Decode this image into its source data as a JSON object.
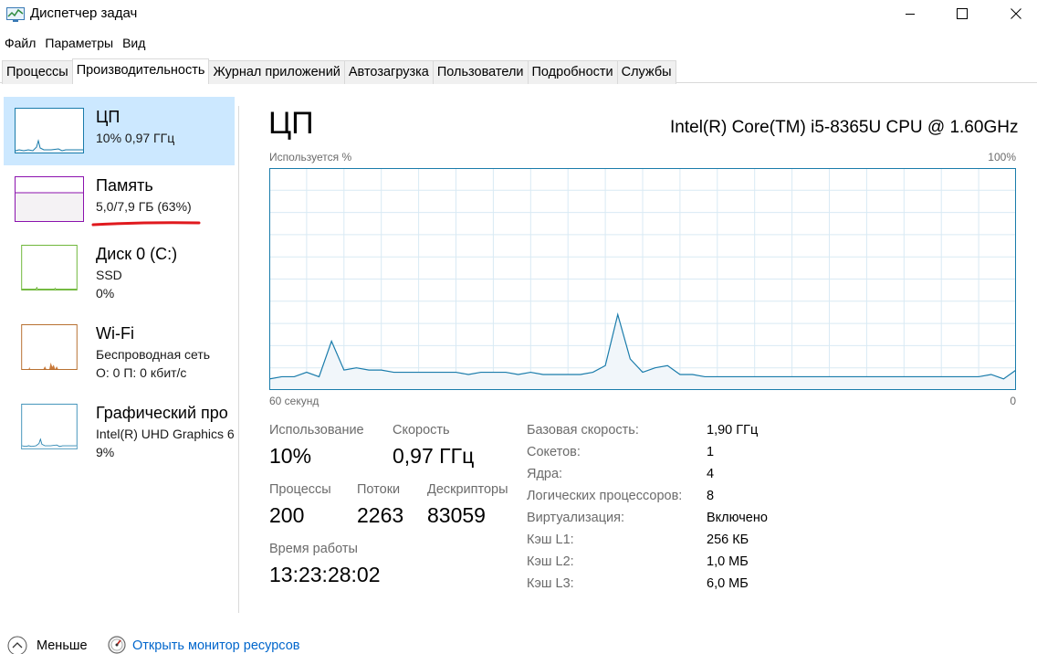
{
  "window": {
    "title": "Диспетчер задач"
  },
  "menu": [
    "Файл",
    "Параметры",
    "Вид"
  ],
  "tabs": [
    {
      "label": "Процессы",
      "active": false
    },
    {
      "label": "Производительность",
      "active": true
    },
    {
      "label": "Журнал приложений",
      "active": false
    },
    {
      "label": "Автозагрузка",
      "active": false
    },
    {
      "label": "Пользователи",
      "active": false
    },
    {
      "label": "Подробности",
      "active": false
    },
    {
      "label": "Службы",
      "active": false
    }
  ],
  "sidebar": {
    "items": [
      {
        "title": "ЦП",
        "sub1": "10% 0,97 ГГц",
        "sub2": "",
        "sub3": "",
        "color": "#1a7cab"
      },
      {
        "title": "Память",
        "sub1": "5,0/7,9 ГБ (63%)",
        "sub2": "",
        "sub3": "",
        "color": "#8b12ae"
      },
      {
        "title": "Диск 0 (C:)",
        "sub1": "SSD",
        "sub2": "0%",
        "sub3": "",
        "color": "#4da60c"
      },
      {
        "title": "Wi-Fi",
        "sub1": "Беспроводная сеть",
        "sub2": "О: 0 П: 0 кбит/с",
        "sub3": "",
        "color": "#a74f01"
      },
      {
        "title": "Графический про",
        "sub1": "Intel(R) UHD Graphics 6",
        "sub2": "9%",
        "sub3": "",
        "color": "#1a7cab"
      }
    ]
  },
  "main": {
    "title": "ЦП",
    "cpu_model": "Intel(R) Core(TM) i5-8365U CPU @ 1.60GHz",
    "graph": {
      "top_left": "Используется %",
      "top_right": "100%",
      "bottom_left": "60 секунд",
      "bottom_right": "0",
      "line_color": "#1a7cab",
      "fill_color": "#f1f6fa",
      "grid_color": "#d9eaf4",
      "usage_percent": [
        5,
        6,
        6,
        8,
        6,
        22,
        9,
        10,
        9,
        9,
        8,
        8,
        8,
        8,
        8,
        8,
        7,
        8,
        8,
        8,
        7,
        8,
        7,
        7,
        7,
        7,
        8,
        11,
        34,
        14,
        8,
        10,
        11,
        7,
        7,
        6,
        6,
        6,
        6,
        6,
        6,
        6,
        6,
        6,
        6,
        6,
        6,
        6,
        6,
        6,
        6,
        6,
        6,
        6,
        6,
        6,
        6,
        6,
        7,
        5,
        9
      ]
    },
    "stats": {
      "usage_label": "Использование",
      "usage_value": "10%",
      "speed_label": "Скорость",
      "speed_value": "0,97 ГГц",
      "processes_label": "Процессы",
      "processes_value": "200",
      "threads_label": "Потоки",
      "threads_value": "2263",
      "handles_label": "Дескрипторы",
      "handles_value": "83059",
      "uptime_label": "Время работы",
      "uptime_value": "13:23:28:02"
    },
    "specs": [
      {
        "label": "Базовая скорость:",
        "value": "1,90 ГГц"
      },
      {
        "label": "Сокетов:",
        "value": "1"
      },
      {
        "label": "Ядра:",
        "value": "4"
      },
      {
        "label": "Логических процессоров:",
        "value": "8"
      },
      {
        "label": "Виртуализация:",
        "value": "Включено"
      },
      {
        "label": "Кэш L1:",
        "value": "256 КБ"
      },
      {
        "label": "Кэш L2:",
        "value": "1,0 МБ"
      },
      {
        "label": "Кэш L3:",
        "value": "6,0 МБ"
      }
    ]
  },
  "bottom": {
    "less_label": "Меньше",
    "monitor_link": "Открыть монитор ресурсов"
  },
  "icons": {
    "app": "task-manager-icon",
    "minimize": "minimize-icon",
    "maximize": "maximize-icon",
    "close": "close-icon",
    "less": "chevron-up-icon",
    "monitor": "resource-monitor-icon"
  }
}
